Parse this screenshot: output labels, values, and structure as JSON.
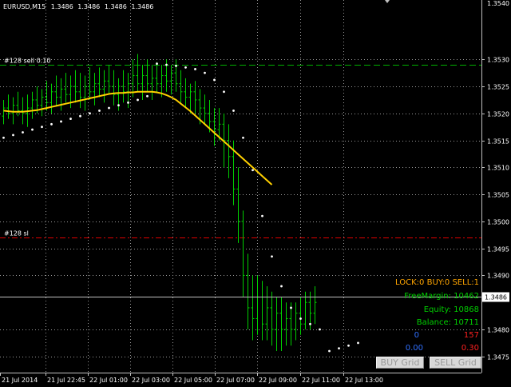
{
  "window": {
    "symbol_caption": "EURUSD,M15",
    "ohlc": [
      "1.3486",
      "1.3486",
      "1.3486",
      "1.3486"
    ]
  },
  "chart_data": {
    "type": "ohlc",
    "title": "EURUSD,M15",
    "x_tick_labels": [
      "21 Jul 2014",
      "21 Jul 22:45",
      "22 Jul 01:00",
      "22 Jul 03:00",
      "22 Jul 05:00",
      "22 Jul 07:00",
      "22 Jul 09:00",
      "22 Jul 11:00",
      "22 Jul 13:00"
    ],
    "y_tick_labels": [
      "1.3530",
      "1.3525",
      "1.3520",
      "1.3515",
      "1.3510",
      "1.3505",
      "1.3500",
      "1.3495",
      "1.3490",
      "1.3480",
      "1.3475"
    ],
    "y_top_label": "1.3540",
    "ylim": [
      1.3472,
      1.3541
    ],
    "current_price": "1.3486",
    "current_price_value": 1.3486,
    "bar_color": "#00d000",
    "ma_color": "#ffd000",
    "sar_color": "#ffffff",
    "bars": [
      [
        1.35195,
        1.35225,
        1.3518,
        1.3521
      ],
      [
        1.3521,
        1.35235,
        1.3519,
        1.352
      ],
      [
        1.352,
        1.3523,
        1.3518,
        1.35215
      ],
      [
        1.35215,
        1.3524,
        1.35195,
        1.35205
      ],
      [
        1.35205,
        1.3523,
        1.3518,
        1.352
      ],
      [
        1.352,
        1.35235,
        1.35175,
        1.3521
      ],
      [
        1.3521,
        1.3524,
        1.3519,
        1.35225
      ],
      [
        1.35225,
        1.3525,
        1.352,
        1.35215
      ],
      [
        1.35215,
        1.35245,
        1.35195,
        1.3523
      ],
      [
        1.3523,
        1.3526,
        1.35205,
        1.3522
      ],
      [
        1.3522,
        1.35255,
        1.352,
        1.3524
      ],
      [
        1.3524,
        1.3527,
        1.35215,
        1.3523
      ],
      [
        1.3523,
        1.35265,
        1.35205,
        1.35245
      ],
      [
        1.35245,
        1.35275,
        1.3522,
        1.35235
      ],
      [
        1.35235,
        1.3527,
        1.3521,
        1.3525
      ],
      [
        1.3525,
        1.3528,
        1.3522,
        1.3524
      ],
      [
        1.3524,
        1.35275,
        1.3521,
        1.3523
      ],
      [
        1.3523,
        1.3527,
        1.35205,
        1.3525
      ],
      [
        1.3525,
        1.35285,
        1.35225,
        1.3524
      ],
      [
        1.3524,
        1.35275,
        1.35215,
        1.35255
      ],
      [
        1.35255,
        1.35285,
        1.3523,
        1.35245
      ],
      [
        1.35245,
        1.3528,
        1.3522,
        1.3526
      ],
      [
        1.3526,
        1.3529,
        1.35235,
        1.3525
      ],
      [
        1.3525,
        1.3528,
        1.35215,
        1.35235
      ],
      [
        1.35235,
        1.35265,
        1.35205,
        1.3525
      ],
      [
        1.3525,
        1.3528,
        1.3522,
        1.3524
      ],
      [
        1.3524,
        1.35275,
        1.3521,
        1.35255
      ],
      [
        1.35255,
        1.353,
        1.3523,
        1.3527
      ],
      [
        1.3527,
        1.3531,
        1.3524,
        1.35255
      ],
      [
        1.35255,
        1.3529,
        1.35225,
        1.3527
      ],
      [
        1.3527,
        1.353,
        1.3524,
        1.35255
      ],
      [
        1.35255,
        1.3529,
        1.35225,
        1.35265
      ],
      [
        1.35265,
        1.35295,
        1.3524,
        1.35255
      ],
      [
        1.35255,
        1.3529,
        1.3523,
        1.3527
      ],
      [
        1.3527,
        1.353,
        1.3524,
        1.3526
      ],
      [
        1.3526,
        1.3529,
        1.35235,
        1.35275
      ],
      [
        1.35275,
        1.353,
        1.3524,
        1.35255
      ],
      [
        1.35255,
        1.3528,
        1.3522,
        1.3524
      ],
      [
        1.3524,
        1.35265,
        1.3521,
        1.3523
      ],
      [
        1.3523,
        1.35255,
        1.352,
        1.3524
      ],
      [
        1.3524,
        1.3526,
        1.352,
        1.35225
      ],
      [
        1.35225,
        1.35245,
        1.3518,
        1.3521
      ],
      [
        1.3521,
        1.35235,
        1.3518,
        1.352
      ],
      [
        1.352,
        1.35225,
        1.35165,
        1.35185
      ],
      [
        1.35185,
        1.3521,
        1.3514,
        1.3517
      ],
      [
        1.3517,
        1.3521,
        1.3515,
        1.3518
      ],
      [
        1.3518,
        1.352,
        1.351,
        1.3515
      ],
      [
        1.3515,
        1.3518,
        1.3508,
        1.3512
      ],
      [
        1.3512,
        1.3515,
        1.3503,
        1.3506
      ],
      [
        1.3506,
        1.351,
        1.3496,
        1.35
      ],
      [
        1.35,
        1.3502,
        1.3486,
        1.349
      ],
      [
        1.349,
        1.3494,
        1.348,
        1.3484
      ],
      [
        1.3484,
        1.349,
        1.3478,
        1.3482
      ],
      [
        1.3482,
        1.349,
        1.3479,
        1.3486
      ],
      [
        1.3486,
        1.3489,
        1.3478,
        1.3481
      ],
      [
        1.3481,
        1.3488,
        1.3478,
        1.3484
      ],
      [
        1.3484,
        1.3487,
        1.3477,
        1.348
      ],
      [
        1.348,
        1.3486,
        1.3476,
        1.3483
      ],
      [
        1.3483,
        1.3486,
        1.3476,
        1.348
      ],
      [
        1.348,
        1.3485,
        1.3477,
        1.3482
      ],
      [
        1.3482,
        1.3485,
        1.3477,
        1.348
      ],
      [
        1.348,
        1.3485,
        1.3478,
        1.3483
      ],
      [
        1.3483,
        1.3486,
        1.3479,
        1.3481
      ],
      [
        1.3481,
        1.3487,
        1.348,
        1.3485
      ],
      [
        1.3485,
        1.3487,
        1.348,
        1.3483
      ],
      [
        1.3483,
        1.3488,
        1.3481,
        1.3485
      ]
    ],
    "moving_average": [
      1.35205,
      1.35204,
      1.35203,
      1.35203,
      1.35203,
      1.35204,
      1.35205,
      1.35206,
      1.35208,
      1.3521,
      1.35212,
      1.35214,
      1.35216,
      1.35218,
      1.3522,
      1.35222,
      1.35224,
      1.35226,
      1.35228,
      1.3523,
      1.35232,
      1.35234,
      1.35236,
      1.35237,
      1.35238,
      1.35238,
      1.35239,
      1.35239,
      1.3524,
      1.3524,
      1.3524,
      1.3524,
      1.35239,
      1.35237,
      1.35234,
      1.3523,
      1.35225,
      1.35218,
      1.35211,
      1.35204,
      1.35196,
      1.35188,
      1.3518,
      1.35172,
      1.35164,
      1.35156,
      1.35148,
      1.3514,
      1.35132,
      1.35124,
      1.35116,
      1.35108,
      1.351,
      1.35092,
      1.35084,
      1.35076,
      1.35068
    ],
    "sar_points": [
      [
        0,
        1.35155
      ],
      [
        2,
        1.3516
      ],
      [
        4,
        1.35165
      ],
      [
        6,
        1.3517
      ],
      [
        8,
        1.35175
      ],
      [
        10,
        1.3518
      ],
      [
        12,
        1.35185
      ],
      [
        14,
        1.3519
      ],
      [
        16,
        1.35195
      ],
      [
        18,
        1.352
      ],
      [
        20,
        1.35205
      ],
      [
        22,
        1.3521
      ],
      [
        24,
        1.35215
      ],
      [
        26,
        1.3522
      ],
      [
        28,
        1.35225
      ],
      [
        30,
        1.35232
      ],
      [
        32,
        1.35292
      ],
      [
        34,
        1.3529
      ],
      [
        36,
        1.35288
      ],
      [
        38,
        1.35285
      ],
      [
        40,
        1.35282
      ],
      [
        42,
        1.35275
      ],
      [
        44,
        1.35262
      ],
      [
        46,
        1.3524
      ],
      [
        48,
        1.35205
      ],
      [
        50,
        1.35155
      ],
      [
        52,
        1.35095
      ],
      [
        54,
        1.3501
      ],
      [
        56,
        1.34935
      ],
      [
        58,
        1.3488
      ],
      [
        60,
        1.3484
      ],
      [
        62,
        1.3482
      ],
      [
        64,
        1.3481
      ],
      [
        66,
        1.348
      ],
      [
        68,
        1.3476
      ],
      [
        70,
        1.34765
      ],
      [
        72,
        1.3477
      ],
      [
        74,
        1.34775
      ]
    ],
    "order_lines": [
      {
        "label": "#128 sell 0.10",
        "price": 1.3529,
        "color": "#00b000"
      },
      {
        "label": "#128 sl",
        "price": 1.3497,
        "color": "#e00000"
      }
    ]
  },
  "panel": {
    "lock_line": "LOCK:0  BUY:0  SELL:1",
    "freemargin": "FreeMargin: 10462",
    "equity": "Equity: 10868",
    "balance": "Balance: 10711",
    "buy_count": "0",
    "sell_points": "157",
    "buy_profit": "0.00",
    "sell_profit": "0.30",
    "colors": {
      "lock": "#ffa500",
      "account": "#00d000",
      "buy": "#3070ff",
      "sell": "#ff2020"
    }
  },
  "buttons": {
    "buy_grid": "BUY Grid",
    "sell_grid": "SELL Grid"
  }
}
